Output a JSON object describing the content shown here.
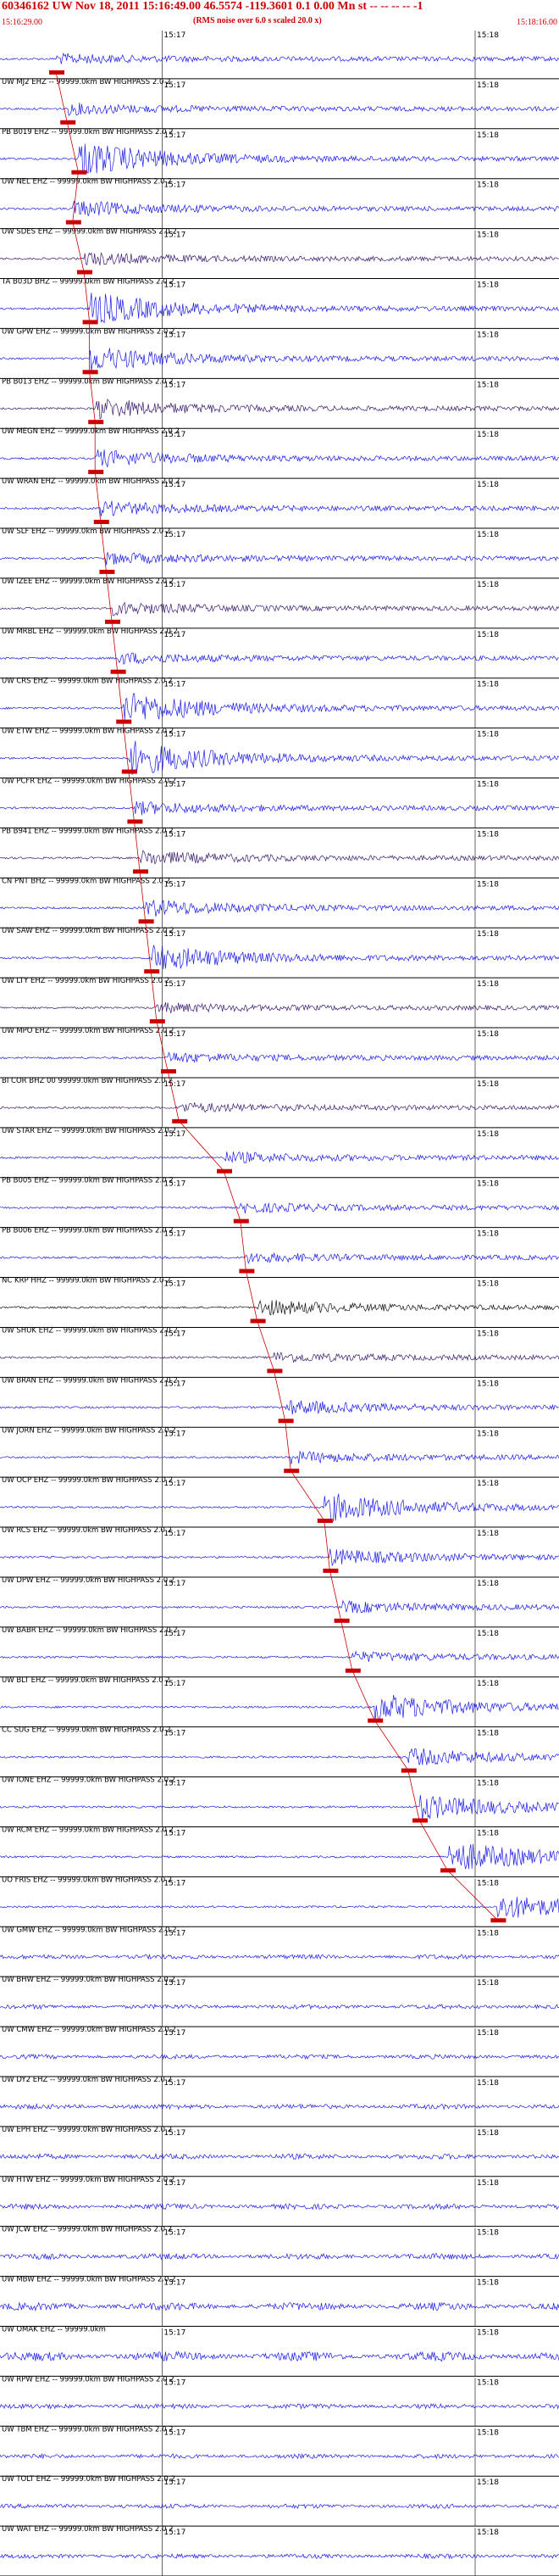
{
  "header": {
    "title": "60346162 UW Nov 18, 2011 15:16:49.00   46.5574 -119.3601  0.1 0.00 Mn st -- -- -- --  -1",
    "subtitle": "(RMS noise over 6.0 s scaled 20.0 x)",
    "start_time": "15:16:29.00",
    "end_time": "15:18:16.00"
  },
  "colors": {
    "trace": "#1a1ae6",
    "trace_dark": "#3a1a6e",
    "trace_black": "#111111",
    "pick": "#cc0000",
    "grid": "#000000",
    "label": "#000000"
  },
  "chart_data": {
    "type": "line",
    "title": "60346162 UW Nov 18, 2011 15:16:49.00   46.5574 -119.3601  0.1 0.00 Mn st -- -- -- --  -1",
    "x_start": "15:16:29.00",
    "x_end": "15:18:16.00",
    "minute_marks": [
      {
        "label": "15:17",
        "frac": 0.29
      },
      {
        "label": "15:18",
        "frac": 0.85
      }
    ],
    "traces": [
      {
        "label": "",
        "color": "blue",
        "pick": 0.1,
        "amp": 0.5
      },
      {
        "label": "UW MJ2 EHZ -- 99999.0km BW  HIGHPASS  2.0  2",
        "color": "blue",
        "pick": 0.12,
        "amp": 0.6
      },
      {
        "label": "PB B019 EHZ -- 99999.0km BW  HIGHPASS  2.0  2",
        "color": "blue",
        "pick": 0.14,
        "amp": 2.2
      },
      {
        "label": "UW NEL EHZ -- 99999.0km BW  HIGHPASS  2.0  2",
        "color": "blue",
        "pick": 0.13,
        "amp": 0.9
      },
      {
        "label": "UW SDES EHZ -- 99999.0km BW  HIGHPASS  2.0  2",
        "color": "dark",
        "pick": 0.15,
        "amp": 0.7
      },
      {
        "label": "TA B03D BHZ -- 99999.0km BW  HIGHPASS  2.0  2",
        "color": "blue",
        "pick": 0.16,
        "amp": 2.0
      },
      {
        "label": "UW GPW EHZ -- 99999.0km BW  HIGHPASS  2.0  2",
        "color": "blue",
        "pick": 0.16,
        "amp": 1.5
      },
      {
        "label": "PB B013 EHZ -- 99999.0km BW  HIGHPASS  2.0  2",
        "color": "dark",
        "pick": 0.17,
        "amp": 1.2
      },
      {
        "label": "UW MEGN EHZ -- 99999.0km BW  HIGHPASS  2.0  2",
        "color": "blue",
        "pick": 0.17,
        "amp": 1.0
      },
      {
        "label": "UW WRAN EHZ -- 99999.0km BW  HIGHPASS  2.0  2",
        "color": "blue",
        "pick": 0.18,
        "amp": 0.8
      },
      {
        "label": "UW SLF EHZ -- 99999.0km BW  HIGHPASS  2.0  2",
        "color": "blue",
        "pick": 0.19,
        "amp": 0.6
      },
      {
        "label": "UW IZEE EHZ -- 99999.0km BW  HIGHPASS  2.0  2",
        "color": "dark",
        "pick": 0.2,
        "amp": 0.7
      },
      {
        "label": "UW MRBL EHZ -- 99999.0km BW  HIGHPASS  2.0  2",
        "color": "blue",
        "pick": 0.21,
        "amp": 0.6
      },
      {
        "label": "UW CRS EHZ -- 99999.0km BW  HIGHPASS  2.0  2",
        "color": "blue",
        "pick": 0.22,
        "amp": 2.0
      },
      {
        "label": "UW ETW EHZ -- 99999.0km BW  HIGHPASS  2.0  2",
        "color": "blue",
        "pick": 0.23,
        "amp": 2.2
      },
      {
        "label": "UW PCFR EHZ -- 99999.0km BW  HIGHPASS  2.0  2",
        "color": "blue",
        "pick": 0.24,
        "amp": 0.7
      },
      {
        "label": "PB B941 EHZ -- 99999.0km BW  HIGHPASS  2.0  2",
        "color": "dark",
        "pick": 0.25,
        "amp": 0.8
      },
      {
        "label": "CN PNT BHZ -- 99999.0km BW  HIGHPASS  2.0  2",
        "color": "blue",
        "pick": 0.26,
        "amp": 1.0
      },
      {
        "label": "UW SAW EHZ -- 99999.0km BW  HIGHPASS  2.0  2",
        "color": "blue",
        "pick": 0.27,
        "amp": 1.6
      },
      {
        "label": "UW LTY EHZ -- 99999.0km BW  HIGHPASS  2.0  2",
        "color": "dark",
        "pick": 0.28,
        "amp": 0.5
      },
      {
        "label": "UW MPO EHZ -- 99999.0km BW  HIGHPASS  2.0  2",
        "color": "blue",
        "pick": 0.3,
        "amp": 0.5
      },
      {
        "label": "BI COR BHZ 00 99999.0km BW  HIGHPASS  2.0  2",
        "color": "dark",
        "pick": 0.32,
        "amp": 0.5
      },
      {
        "label": "UW STAR EHZ -- 99999.0km BW  HIGHPASS  2.0  2",
        "color": "blue",
        "pick": 0.4,
        "amp": 0.6
      },
      {
        "label": "PB B005 EHZ -- 99999.0km BW  HIGHPASS  2.0  2",
        "color": "blue",
        "pick": 0.43,
        "amp": 0.5
      },
      {
        "label": "PB B006 EHZ -- 99999.0km BW  HIGHPASS  2.0  2",
        "color": "blue",
        "pick": 0.44,
        "amp": 0.5
      },
      {
        "label": "NC KRP HHZ -- 99999.0km BW  HIGHPASS  2.0  2",
        "color": "black",
        "pick": 0.46,
        "amp": 0.9
      },
      {
        "label": "UW SHUK EHZ -- 99999.0km BW  HIGHPASS  2.0  2",
        "color": "dark",
        "pick": 0.49,
        "amp": 0.5
      },
      {
        "label": "UW BRAN EHZ -- 99999.0km BW  HIGHPASS  2.0  2",
        "color": "blue",
        "pick": 0.51,
        "amp": 0.8
      },
      {
        "label": "UW JORN EHZ -- 99999.0km BW  HIGHPASS  2.0  2",
        "color": "blue",
        "pick": 0.52,
        "amp": 0.6
      },
      {
        "label": "UW OCP EHZ -- 99999.0km BW  HIGHPASS  2.0  2",
        "color": "blue",
        "pick": 0.58,
        "amp": 1.8
      },
      {
        "label": "UW RCS EHZ -- 99999.0km BW  HIGHPASS  2.0  2",
        "color": "blue",
        "pick": 0.59,
        "amp": 0.9
      },
      {
        "label": "UW DPW EHZ -- 99999.0km BW  HIGHPASS  2.0  2",
        "color": "blue",
        "pick": 0.61,
        "amp": 0.6
      },
      {
        "label": "UW BABR EHZ -- 99999.0km BW  HIGHPASS  2.0  2",
        "color": "blue",
        "pick": 0.63,
        "amp": 0.5
      },
      {
        "label": "UW BLT EHZ -- 99999.0km BW  HIGHPASS  2.0  2",
        "color": "blue",
        "pick": 0.67,
        "amp": 1.7
      },
      {
        "label": "CC SUG EHZ -- 99999.0km BW  HIGHPASS  2.0  2",
        "color": "blue",
        "pick": 0.73,
        "amp": 1.0
      },
      {
        "label": "UW IONE EHZ -- 99999.0km BW  HIGHPASS  2.0  2",
        "color": "blue",
        "pick": 0.75,
        "amp": 1.5
      },
      {
        "label": "UW RCM EHZ -- 99999.0km BW  HIGHPASS  2.0  2",
        "color": "blue",
        "pick": 0.8,
        "amp": 2.0
      },
      {
        "label": "UO FRIS EHZ -- 99999.0km BW  HIGHPASS  2.0  2",
        "color": "blue",
        "pick": 0.89,
        "amp": 1.5
      },
      {
        "label": "UW GMW EHZ -- 99999.0km BW  HIGHPASS  2.0  2",
        "color": "blue",
        "pick": null,
        "amp": 0.5
      },
      {
        "label": "UW BHW EHZ -- 99999.0km BW  HIGHPASS  2.0  2",
        "color": "blue",
        "pick": null,
        "amp": 0.5
      },
      {
        "label": "UW CMW EHZ -- 99999.0km BW  HIGHPASS  2.0  2",
        "color": "blue",
        "pick": null,
        "amp": 0.5
      },
      {
        "label": "UW DY2 EHZ -- 99999.0km BW  HIGHPASS  2.0  2",
        "color": "blue",
        "pick": null,
        "amp": 0.6
      },
      {
        "label": "UW EPH EHZ -- 99999.0km BW  HIGHPASS  2.0  2",
        "color": "blue",
        "pick": null,
        "amp": 0.7
      },
      {
        "label": "UW HTW EHZ -- 99999.0km BW  HIGHPASS  2.0  2",
        "color": "blue",
        "pick": null,
        "amp": 0.7
      },
      {
        "label": "UW JCW EHZ -- 99999.0km BW  HIGHPASS  2.0  2",
        "color": "blue",
        "pick": null,
        "amp": 0.8
      },
      {
        "label": "UW MBW EHZ -- 99999.0km BW  HIGHPASS  2.0  2",
        "color": "blue",
        "pick": null,
        "amp": 1.2
      },
      {
        "label": "UW OMAK EHZ -- 99999.0km",
        "color": "blue",
        "pick": null,
        "amp": 1.5
      },
      {
        "label": "UW RPW EHZ -- 99999.0km BW  HIGHPASS  2.0  2",
        "color": "blue",
        "pick": null,
        "amp": 0.6
      },
      {
        "label": "UW TBM EHZ -- 99999.0km BW  HIGHPASS  2.0  2",
        "color": "blue",
        "pick": null,
        "amp": 0.5
      },
      {
        "label": "UW TOLT EHZ -- 99999.0km BW  HIGHPASS  2.0  2",
        "color": "blue",
        "pick": null,
        "amp": 0.5
      },
      {
        "label": "UW WAT EHZ -- 99999.0km BW  HIGHPASS  2.0  2",
        "color": "blue",
        "pick": null,
        "amp": 0.5
      }
    ]
  }
}
